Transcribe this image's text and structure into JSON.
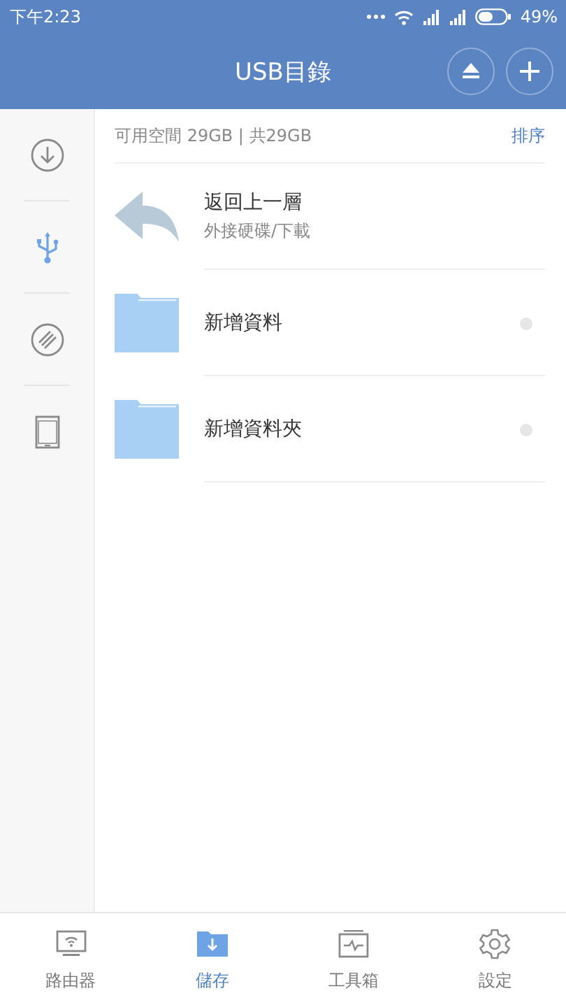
{
  "status_bar": {
    "time": "下午2:23",
    "battery": "49%"
  },
  "header": {
    "title": "USB目錄",
    "actions": [
      {
        "kind": "eject"
      },
      {
        "kind": "add"
      }
    ]
  },
  "sidebar": {
    "items": [
      {
        "kind": "download",
        "selected": false
      },
      {
        "kind": "usb",
        "selected": true
      },
      {
        "kind": "slash",
        "selected": false
      },
      {
        "kind": "tablet",
        "selected": false
      }
    ]
  },
  "storage_info": {
    "text": "可用空間 29GB | 共29GB",
    "sort": "排序"
  },
  "files": [
    {
      "kind": "back",
      "name": "返回上一層",
      "path": "外接硬碟/下載"
    },
    {
      "kind": "folder",
      "name": "新增資料",
      "selected": false
    },
    {
      "kind": "folder",
      "name": "新增資料夾",
      "selected": false
    }
  ],
  "tabs": [
    {
      "kind": "router",
      "label": "路由器",
      "selected": false
    },
    {
      "kind": "storage",
      "label": "儲存",
      "selected": true
    },
    {
      "kind": "tools",
      "label": "工具箱",
      "selected": false
    },
    {
      "kind": "settings",
      "label": "設定",
      "selected": false
    }
  ]
}
